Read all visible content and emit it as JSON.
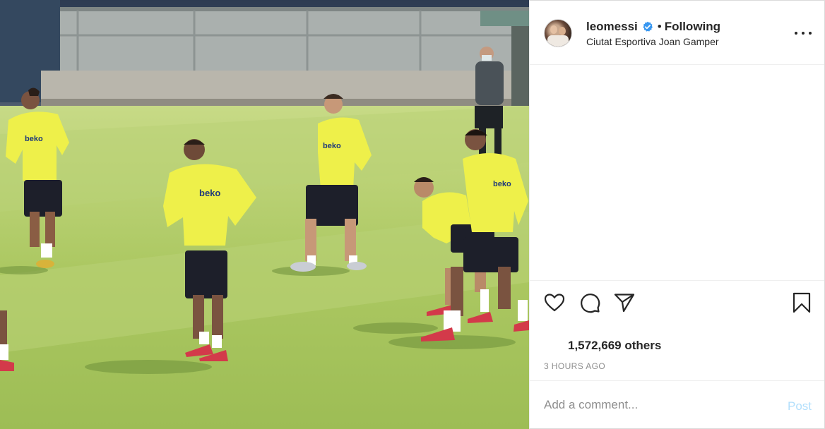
{
  "post": {
    "username": "leomessi",
    "verified": true,
    "separator": "•",
    "follow_status": "Following",
    "location": "Ciutat Esportiva Joan Gamper",
    "likes_text": "1,572,669 others",
    "timestamp": "3 HOURS AGO",
    "photo_sponsor_text": "beko"
  },
  "comment_box": {
    "placeholder": "Add a comment...",
    "post_label": "Post"
  },
  "icons": {
    "like": "heart-icon",
    "comment": "comment-icon",
    "share": "send-icon",
    "save": "bookmark-icon",
    "more": "more-options-icon",
    "verified": "verified-badge-icon"
  },
  "colors": {
    "verified_blue": "#3897f0",
    "post_button_disabled": "#b2dffc",
    "muted_text": "#8e8e8e",
    "jersey_yellow": "#eef04a"
  }
}
